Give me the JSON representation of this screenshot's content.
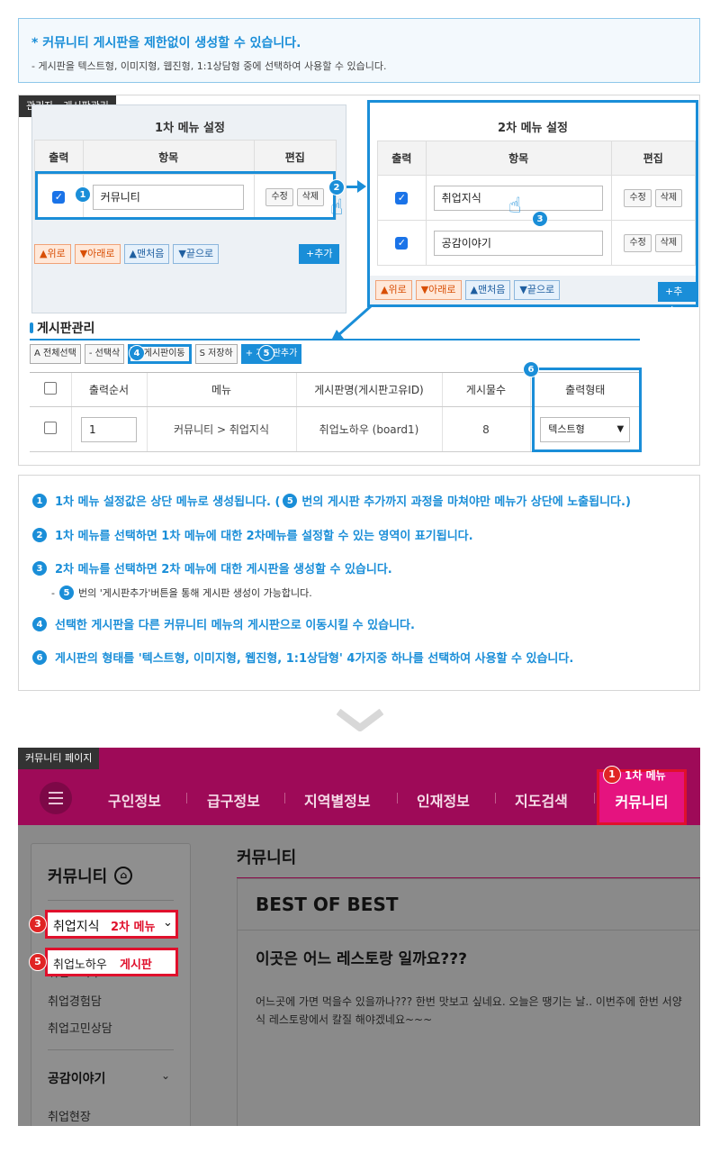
{
  "notice": {
    "title": "* 커뮤니티 게시판을 제한없이 생성할 수 있습니다.",
    "sub": "- 게시판을 텍스트형, 이미지형, 웹진형, 1:1상담형 중에 선택하여 사용할 수 있습니다."
  },
  "admin": {
    "tag": "관리자 - 게시판관리",
    "menu1": {
      "title": "1차 메뉴 설정",
      "headers": [
        "출력",
        "항목",
        "편집"
      ],
      "item": "커뮤니티",
      "edit": "수정",
      "del": "삭제"
    },
    "menu2": {
      "title": "2차 메뉴 설정",
      "headers": [
        "출력",
        "항목",
        "편집"
      ],
      "items": [
        "취업지식",
        "공감이야기"
      ],
      "edit": "수정",
      "del": "삭제"
    },
    "order_buttons": [
      "▲위로",
      "▼아래로",
      "▲맨처음",
      "▼끝으로"
    ],
    "add": "+추가",
    "board": {
      "title": "게시판관리",
      "toolbar": [
        "A 전체선택",
        "- 선택삭",
        "게시판이동",
        "S 저장하",
        "+ 게시판추가"
      ],
      "headers": [
        "출력순서",
        "메뉴",
        "게시판명(게시판고유ID)",
        "게시물수",
        "출력형태"
      ],
      "row": {
        "order": "1",
        "menu": "커뮤니티 > 취업지식",
        "name": "취업노하우 (board1)",
        "count": "8",
        "type": "텍스트형"
      }
    }
  },
  "steps": {
    "n1": "1",
    "n2": "2",
    "n3": "3",
    "n4": "4",
    "n5": "5",
    "n6": "6",
    "d1a": "1차 메뉴 설정값은 상단 메뉴로 생성됩니다. (",
    "d1b": "번의 게시판 추가까지 과정을 마쳐야만 메뉴가 상단에 노출됩니다.)",
    "d2": "1차 메뉴를 선택하면 1차 메뉴에 대한 2차메뉴를 설정할 수 있는 영역이 표기됩니다.",
    "d3": "2차 메뉴를 선택하면 2차 메뉴에 대한 게시판을 생성할 수 있습니다.",
    "d3_sub_pre": "-",
    "d3_sub": "번의 '게시판추가'버튼을 통해 게시판 생성이 가능합니다.",
    "d4": "선택한 게시판을 다른 커뮤니티 메뉴의 게시판으로 이동시킬 수 있습니다.",
    "d6": "게시판의 형태를 '텍스트형, 이미지형, 웹진형, 1:1상담형' 4가지중 하나를 선택하여 사용할 수 있습니다."
  },
  "preview": {
    "tag": "커뮤니티 페이지",
    "nav": [
      "구인정보",
      "급구정보",
      "지역별정보",
      "인재정보",
      "지도검색",
      "커뮤니티"
    ],
    "label1": "1차 메뉴",
    "label2": "2차 메뉴",
    "label_board": "게시판",
    "sidebar": {
      "title": "커뮤니티",
      "group1": "취업지식",
      "items1": [
        "취업노하우",
        "취업경험담",
        "취업고민상담"
      ],
      "group2": "공감이야기",
      "items2": [
        "취업현장"
      ]
    },
    "content": {
      "heading": "커뮤니티",
      "best": "BEST OF BEST",
      "post_title": "이곳은 어느 레스토랑 일까요???",
      "post_body": "어느곳에 가면 먹을수 있을까나??? 한번 맛보고 싶네요. 오늘은 땡기는 날.. 이번주에 한번 서양식 레스토랑에서 칼질 해야겠네요~~~"
    }
  },
  "colors": {
    "accent": "#1a8ed8",
    "nav": "#9e0a58",
    "highlight": "#e0102c"
  }
}
